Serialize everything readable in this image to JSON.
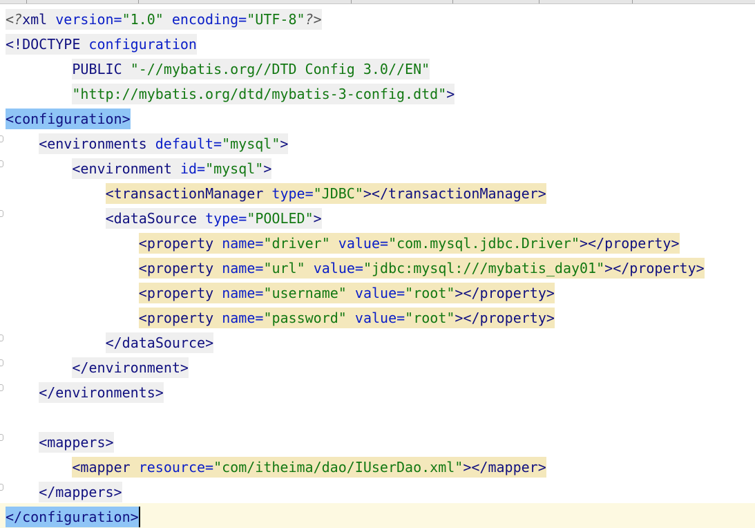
{
  "editor": {
    "lines": [
      {
        "indent": 0,
        "segments": [
          {
            "t": "<?",
            "c": "t-pi"
          },
          {
            "t": "xml ",
            "c": "t-tag"
          },
          {
            "t": "version=",
            "c": "t-attr"
          },
          {
            "t": "\"1.0\"",
            "c": "t-val"
          },
          {
            "t": " encoding=",
            "c": "t-attr"
          },
          {
            "t": "\"UTF-8\"",
            "c": "t-val"
          },
          {
            "t": "?>",
            "c": "t-pi"
          }
        ],
        "hl": "hl-gray"
      },
      {
        "indent": 0,
        "segments": [
          {
            "t": "<!DOCTYPE ",
            "c": "t-tag"
          },
          {
            "t": "configuration",
            "c": "t-attr"
          }
        ],
        "hl": "hl-gray"
      },
      {
        "indent": 8,
        "segments": [
          {
            "t": "PUBLIC ",
            "c": "t-tag"
          },
          {
            "t": "\"-//mybatis.org//DTD Config 3.0//EN\"",
            "c": "t-val"
          }
        ],
        "hl": "hl-gray"
      },
      {
        "indent": 8,
        "segments": [
          {
            "t": "\"http://mybatis.org/dtd/mybatis-3-config.dtd\"",
            "c": "t-val"
          },
          {
            "t": ">",
            "c": "t-tag"
          }
        ],
        "hl": "hl-gray"
      },
      {
        "indent": 0,
        "segments": [
          {
            "t": "<configuration>",
            "c": "t-tag"
          }
        ],
        "hl": "hl-blue"
      },
      {
        "indent": 4,
        "segments": [
          {
            "t": "<environments ",
            "c": "t-tag"
          },
          {
            "t": "default=",
            "c": "t-attr"
          },
          {
            "t": "\"mysql\"",
            "c": "t-val"
          },
          {
            "t": ">",
            "c": "t-tag"
          }
        ],
        "hl": "hl-gray"
      },
      {
        "indent": 8,
        "segments": [
          {
            "t": "<environment ",
            "c": "t-tag"
          },
          {
            "t": "id=",
            "c": "t-attr"
          },
          {
            "t": "\"mysql\"",
            "c": "t-val"
          },
          {
            "t": ">",
            "c": "t-tag"
          }
        ],
        "hl": "hl-gray"
      },
      {
        "indent": 12,
        "segments": [
          {
            "t": "<transactionManager ",
            "c": "t-tag"
          },
          {
            "t": "type=",
            "c": "t-attr"
          },
          {
            "t": "\"JDBC\"",
            "c": "t-val"
          },
          {
            "t": "></transactionManager>",
            "c": "t-tag"
          }
        ],
        "hl": "hl-yellow"
      },
      {
        "indent": 12,
        "segments": [
          {
            "t": "<dataSource ",
            "c": "t-tag"
          },
          {
            "t": "type=",
            "c": "t-attr"
          },
          {
            "t": "\"POOLED\"",
            "c": "t-val"
          },
          {
            "t": ">",
            "c": "t-tag"
          }
        ],
        "hl": "hl-gray"
      },
      {
        "indent": 16,
        "segments": [
          {
            "t": "<property ",
            "c": "t-tag"
          },
          {
            "t": "name=",
            "c": "t-attr"
          },
          {
            "t": "\"driver\"",
            "c": "t-val"
          },
          {
            "t": " value=",
            "c": "t-attr"
          },
          {
            "t": "\"com.mysql.jdbc.Driver\"",
            "c": "t-val"
          },
          {
            "t": "></property>",
            "c": "t-tag"
          }
        ],
        "hl": "hl-yellow"
      },
      {
        "indent": 16,
        "segments": [
          {
            "t": "<property ",
            "c": "t-tag"
          },
          {
            "t": "name=",
            "c": "t-attr"
          },
          {
            "t": "\"url\"",
            "c": "t-val"
          },
          {
            "t": " value=",
            "c": "t-attr"
          },
          {
            "t": "\"jdbc:mysql:///mybatis_day01\"",
            "c": "t-val"
          },
          {
            "t": "></property>",
            "c": "t-tag"
          }
        ],
        "hl": "hl-yellow"
      },
      {
        "indent": 16,
        "segments": [
          {
            "t": "<property ",
            "c": "t-tag"
          },
          {
            "t": "name=",
            "c": "t-attr"
          },
          {
            "t": "\"username\"",
            "c": "t-val"
          },
          {
            "t": " value=",
            "c": "t-attr"
          },
          {
            "t": "\"root\"",
            "c": "t-val"
          },
          {
            "t": "></property>",
            "c": "t-tag"
          }
        ],
        "hl": "hl-yellow"
      },
      {
        "indent": 16,
        "segments": [
          {
            "t": "<property ",
            "c": "t-tag"
          },
          {
            "t": "name=",
            "c": "t-attr"
          },
          {
            "t": "\"password\"",
            "c": "t-val"
          },
          {
            "t": " value=",
            "c": "t-attr"
          },
          {
            "t": "\"root\"",
            "c": "t-val"
          },
          {
            "t": "></property>",
            "c": "t-tag"
          }
        ],
        "hl": "hl-yellow"
      },
      {
        "indent": 12,
        "segments": [
          {
            "t": "</dataSource>",
            "c": "t-tag"
          }
        ],
        "hl": "hl-gray"
      },
      {
        "indent": 8,
        "segments": [
          {
            "t": "</environment>",
            "c": "t-tag"
          }
        ],
        "hl": "hl-gray"
      },
      {
        "indent": 4,
        "segments": [
          {
            "t": "</environments>",
            "c": "t-tag"
          }
        ],
        "hl": "hl-gray"
      },
      {
        "indent": 0,
        "segments": [],
        "hl": ""
      },
      {
        "indent": 4,
        "segments": [
          {
            "t": "<mappers>",
            "c": "t-tag"
          }
        ],
        "hl": "hl-gray"
      },
      {
        "indent": 8,
        "segments": [
          {
            "t": "<mapper ",
            "c": "t-tag"
          },
          {
            "t": "resource=",
            "c": "t-attr"
          },
          {
            "t": "\"com/itheima/dao/IUserDao.xml\"",
            "c": "t-val"
          },
          {
            "t": "></mapper>",
            "c": "t-tag"
          }
        ],
        "hl": "hl-yellow"
      },
      {
        "indent": 4,
        "segments": [
          {
            "t": "</mappers>",
            "c": "t-tag"
          }
        ],
        "hl": "hl-gray"
      },
      {
        "indent": 0,
        "segments": [
          {
            "t": "</configuration>",
            "c": "t-tag"
          }
        ],
        "hl": "hl-blue",
        "current": true
      }
    ]
  }
}
